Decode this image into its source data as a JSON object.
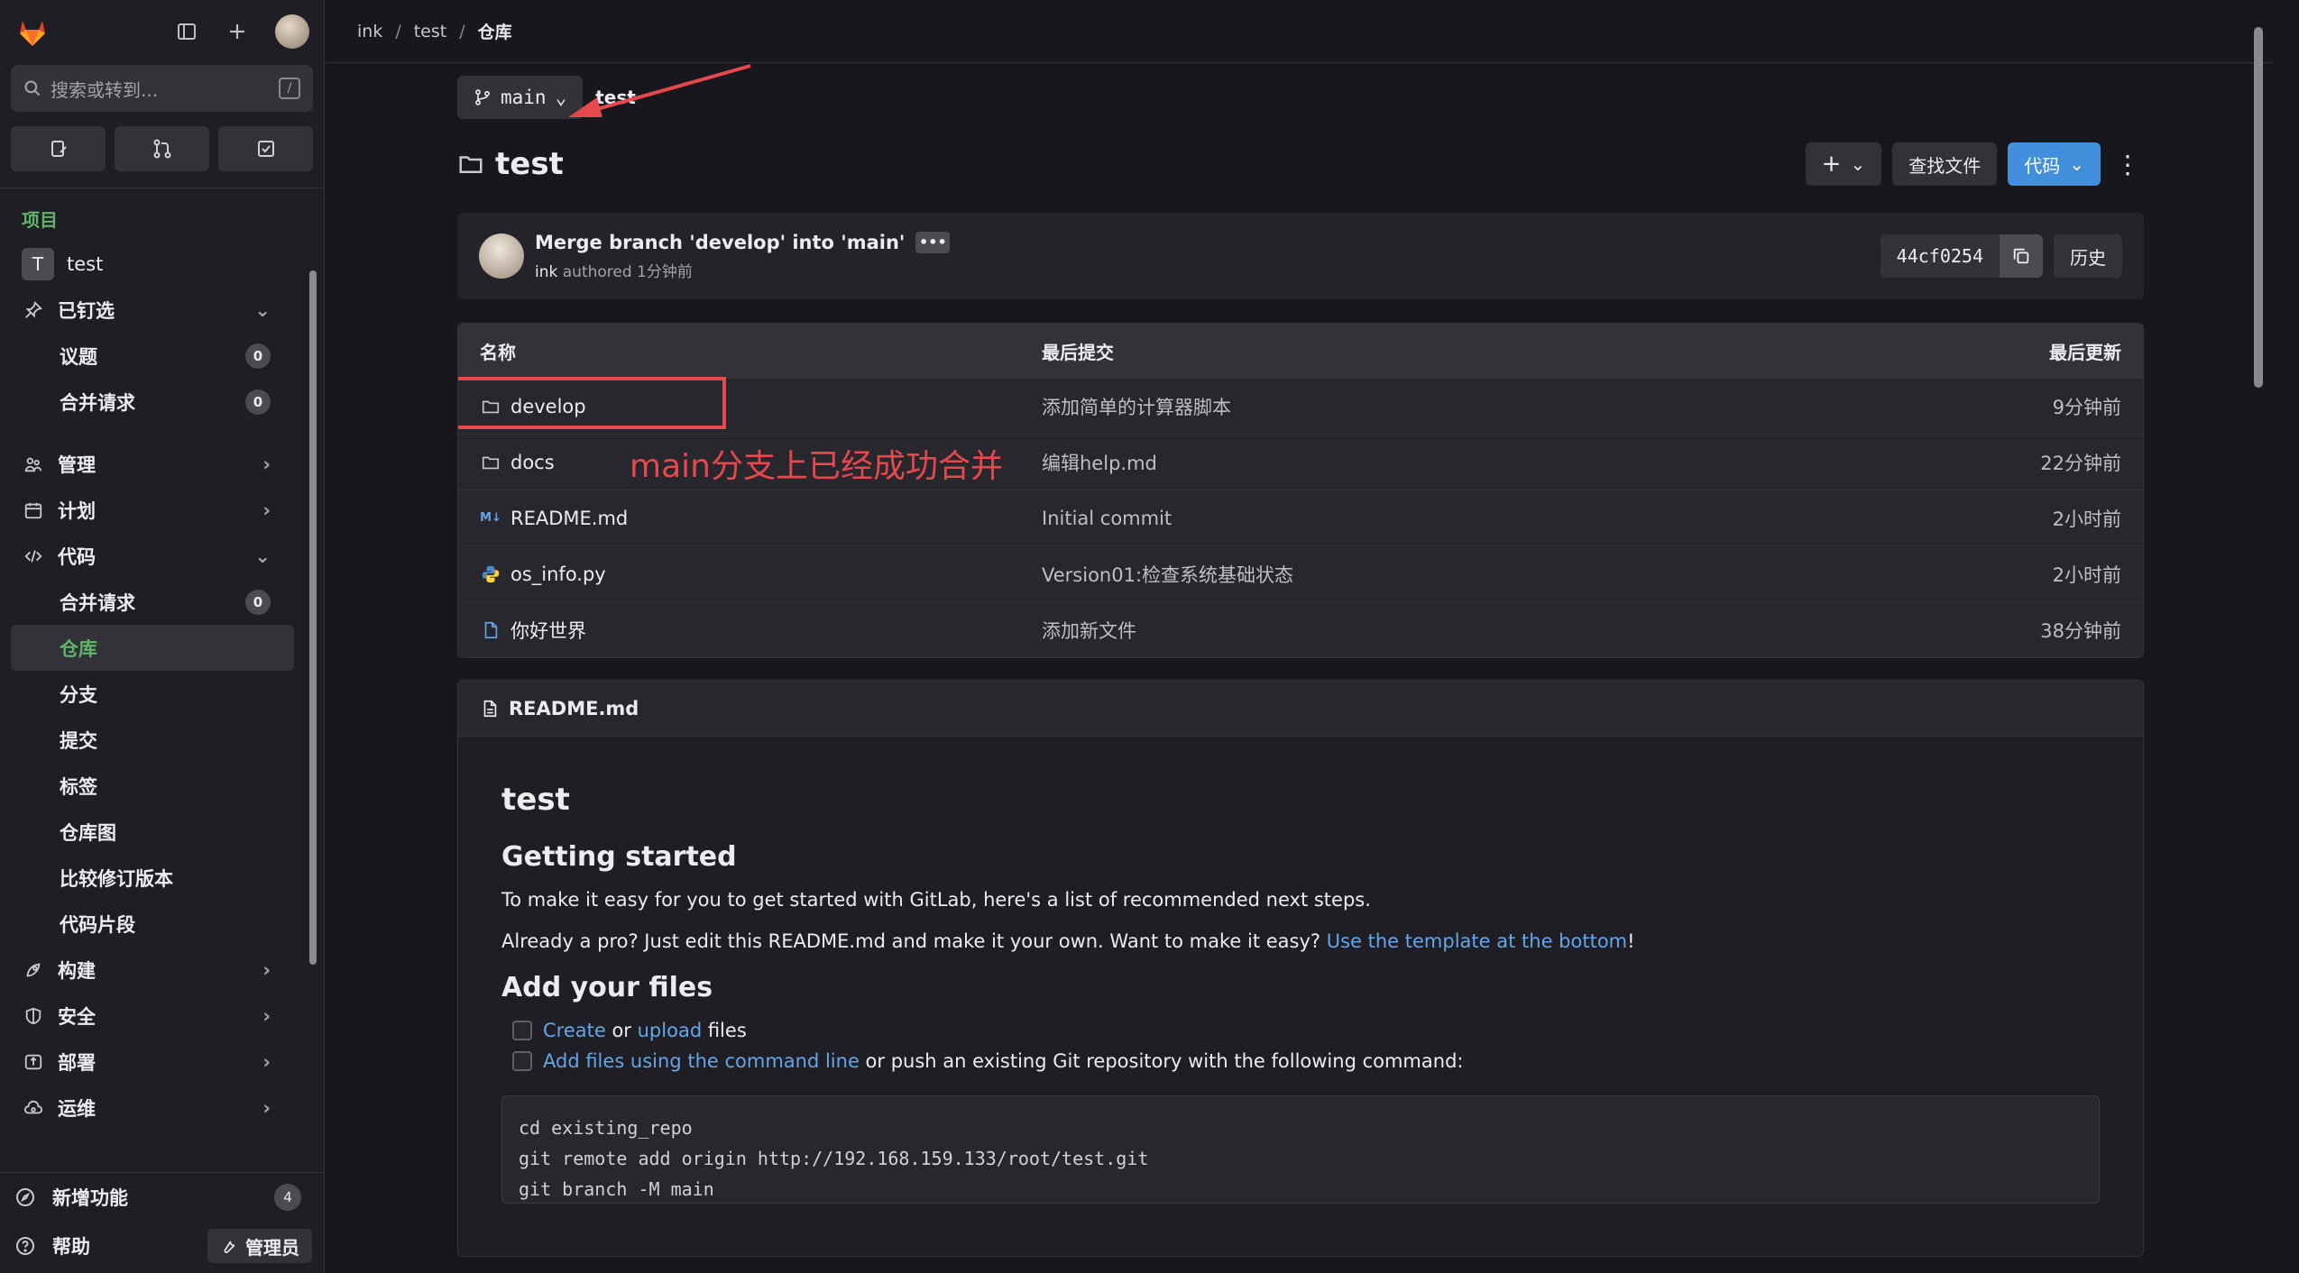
{
  "sidebar": {
    "search_placeholder": "搜索或转到...",
    "search_shortcut": "/",
    "section_title": "项目",
    "project_badge": "T",
    "project_name": "test",
    "pinned": {
      "label": "已钉选",
      "items": [
        {
          "label": "议题",
          "count": "0"
        },
        {
          "label": "合并请求",
          "count": "0"
        }
      ]
    },
    "groups": [
      {
        "label": "管理"
      },
      {
        "label": "计划"
      },
      {
        "label": "代码"
      }
    ],
    "code_items": [
      {
        "label": "合并请求",
        "count": "0"
      },
      {
        "label": "仓库"
      },
      {
        "label": "分支"
      },
      {
        "label": "提交"
      },
      {
        "label": "标签"
      },
      {
        "label": "仓库图"
      },
      {
        "label": "比较修订版本"
      },
      {
        "label": "代码片段"
      }
    ],
    "more_groups": [
      {
        "label": "构建"
      },
      {
        "label": "安全"
      },
      {
        "label": "部署"
      },
      {
        "label": "运维"
      }
    ],
    "bottom": {
      "whats_new": "新增功能",
      "whats_new_count": "4",
      "help": "帮助",
      "admin": "管理员"
    }
  },
  "breadcrumb": [
    "ink",
    "test",
    "仓库"
  ],
  "branch": {
    "name": "main",
    "path": "test"
  },
  "repo_title": "test",
  "actions": {
    "find_file": "查找文件",
    "code": "代码",
    "history": "历史"
  },
  "commit": {
    "title": "Merge branch 'develop' into 'main'",
    "author": "ink",
    "authored": "authored 1分钟前",
    "sha": "44cf0254"
  },
  "table": {
    "headers": {
      "name": "名称",
      "commit": "最后提交",
      "updated": "最后更新"
    },
    "rows": [
      {
        "name": "develop",
        "icon": "folder-icon",
        "commit": "添加简单的计算器脚本",
        "updated": "9分钟前"
      },
      {
        "name": "docs",
        "icon": "folder-icon",
        "commit": "编辑help.md",
        "updated": "22分钟前"
      },
      {
        "name": "README.md",
        "icon": "markdown-icon",
        "commit": "Initial commit",
        "updated": "2小时前"
      },
      {
        "name": "os_info.py",
        "icon": "python-icon",
        "commit": "Version01:检查系统基础状态",
        "updated": "2小时前"
      },
      {
        "name": "你好世界",
        "icon": "file-icon",
        "commit": "添加新文件",
        "updated": "38分钟前"
      }
    ]
  },
  "annotation": "main分支上已经成功合并",
  "readme": {
    "file": "README.md",
    "h1": "test",
    "h2_started": "Getting started",
    "p1": "To make it easy for you to get started with GitLab, here's a list of recommended next steps.",
    "p2_pre": "Already a pro? Just edit this README.md and make it your own. Want to make it easy? ",
    "p2_link": "Use the template at the bottom",
    "p2_post": "!",
    "h2_files": "Add your files",
    "task1_create": "Create",
    "task1_or": " or ",
    "task1_upload": "upload",
    "task1_files": " files",
    "task2_link": "Add files using the command line",
    "task2_rest": " or push an existing Git repository with the following command:",
    "code": [
      "cd existing_repo",
      "git remote add origin http://192.168.159.133/root/test.git",
      "git branch -M main"
    ]
  },
  "colors": {
    "accent_green": "#5fb46a",
    "primary_blue": "#428fdc",
    "annotation_red": "#e5484d"
  }
}
